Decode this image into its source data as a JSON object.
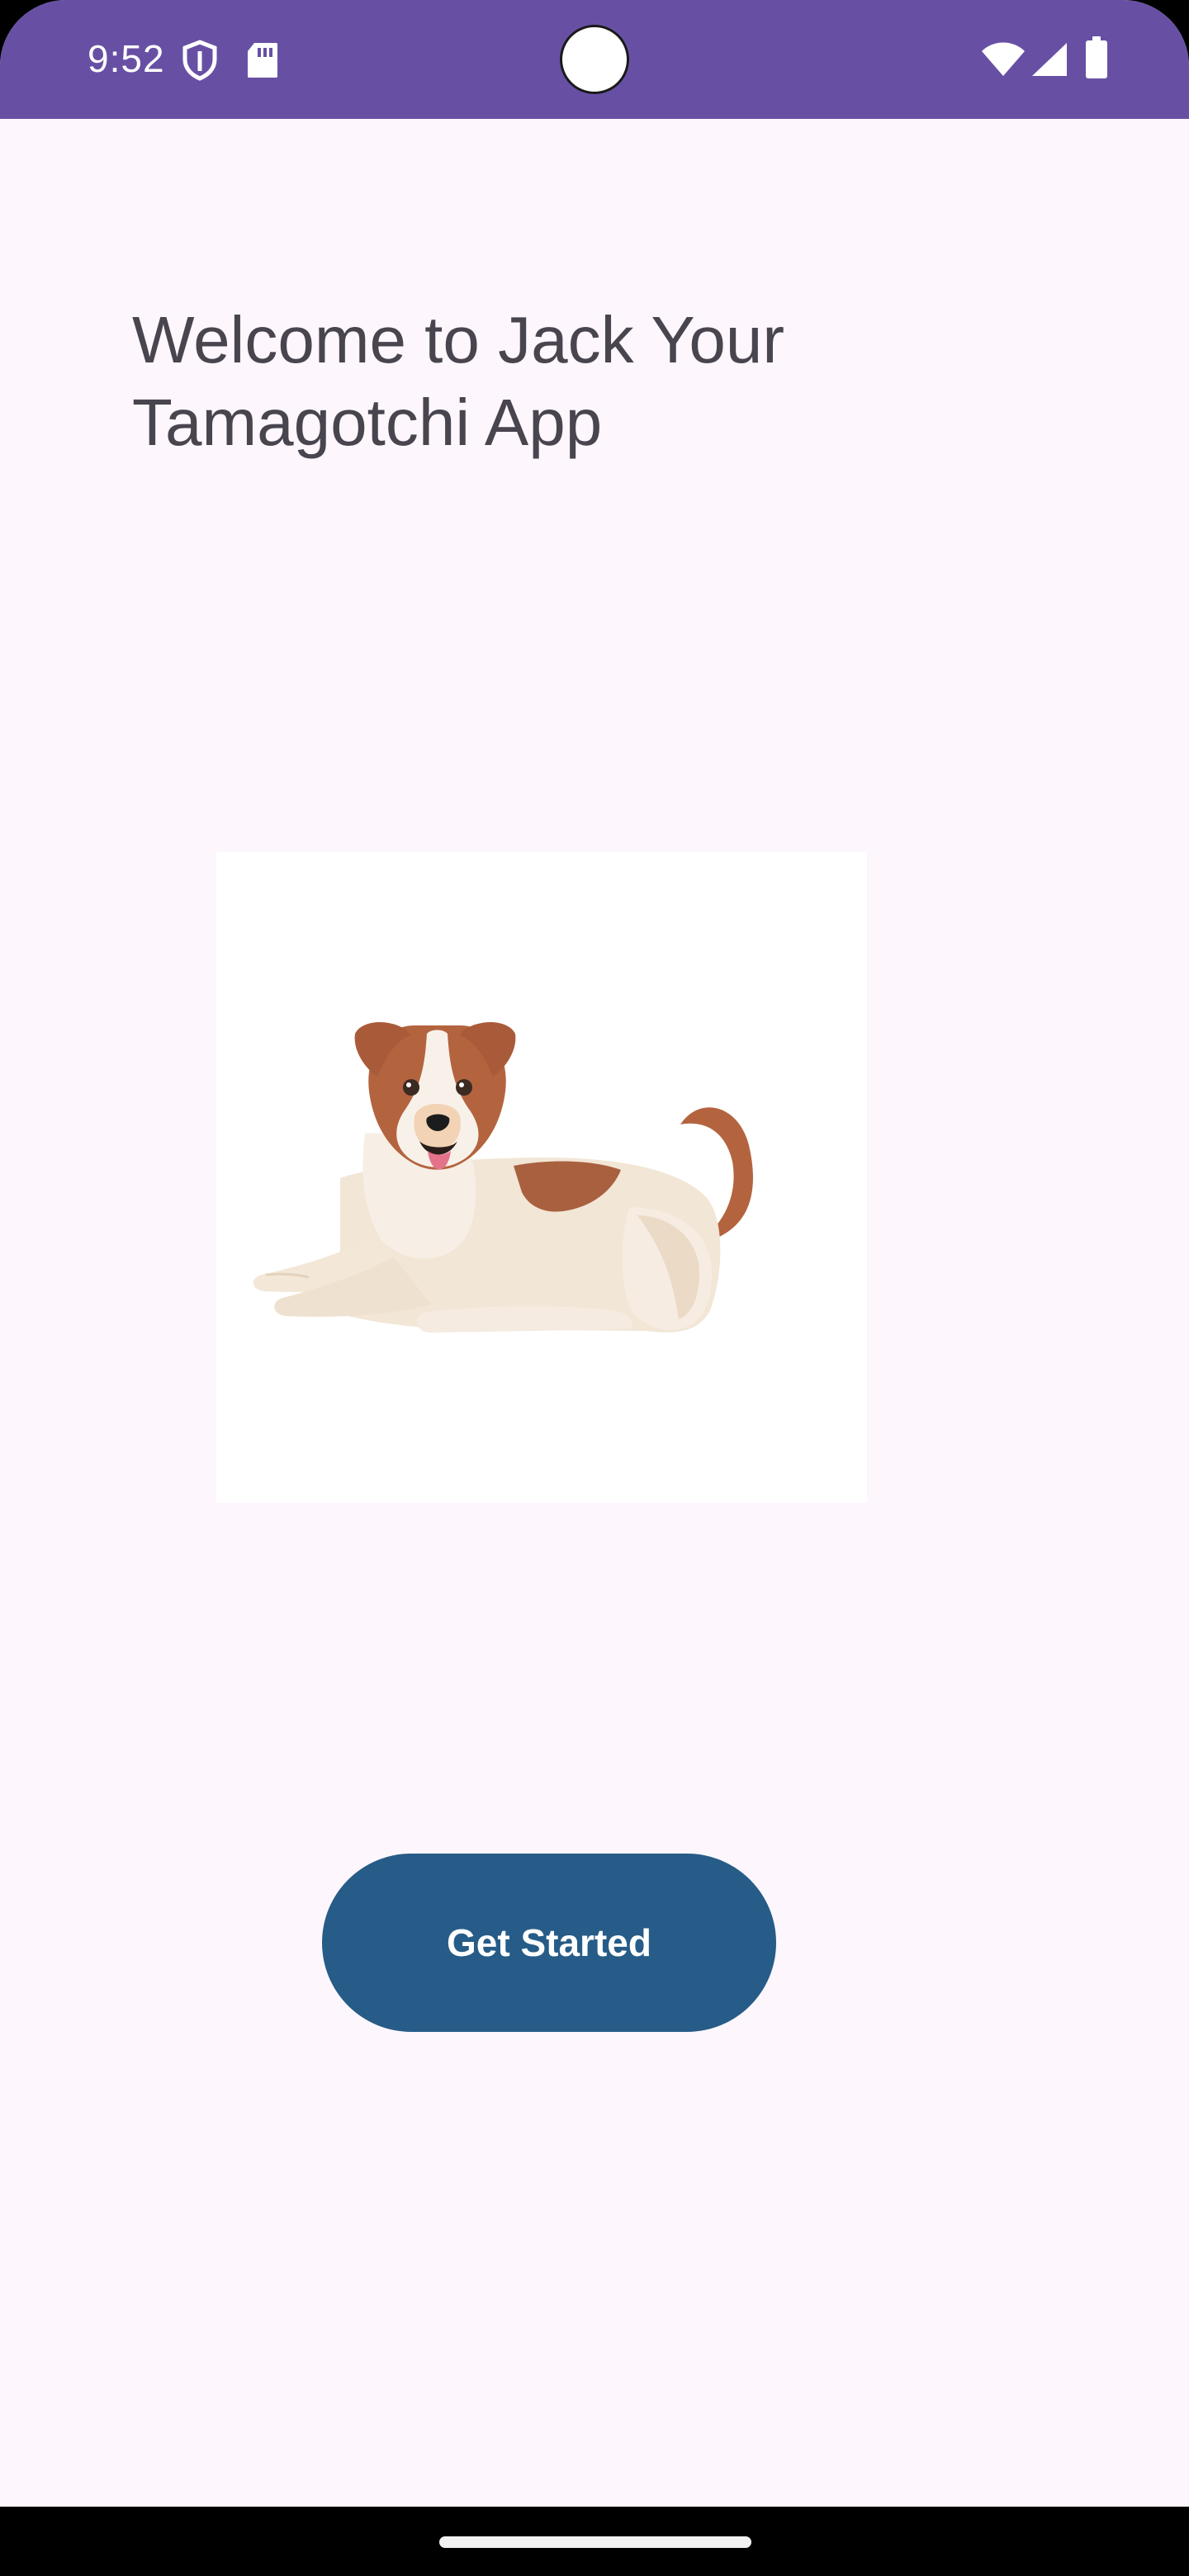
{
  "status_bar": {
    "time": "9:52",
    "background_color": "#6750a4",
    "left_icons": [
      "shield-icon",
      "sd-card-icon"
    ],
    "right_icons": [
      "wifi-icon",
      "cellular-signal-icon",
      "battery-icon"
    ]
  },
  "welcome": {
    "title": "Welcome to Jack Your Tamagotchi App"
  },
  "hero_image": {
    "icon": "dog-illustration"
  },
  "actions": {
    "get_started_label": "Get Started",
    "button_color": "#265c87"
  },
  "colors": {
    "page_background": "#fdf6fd",
    "title_text": "#49454f"
  }
}
